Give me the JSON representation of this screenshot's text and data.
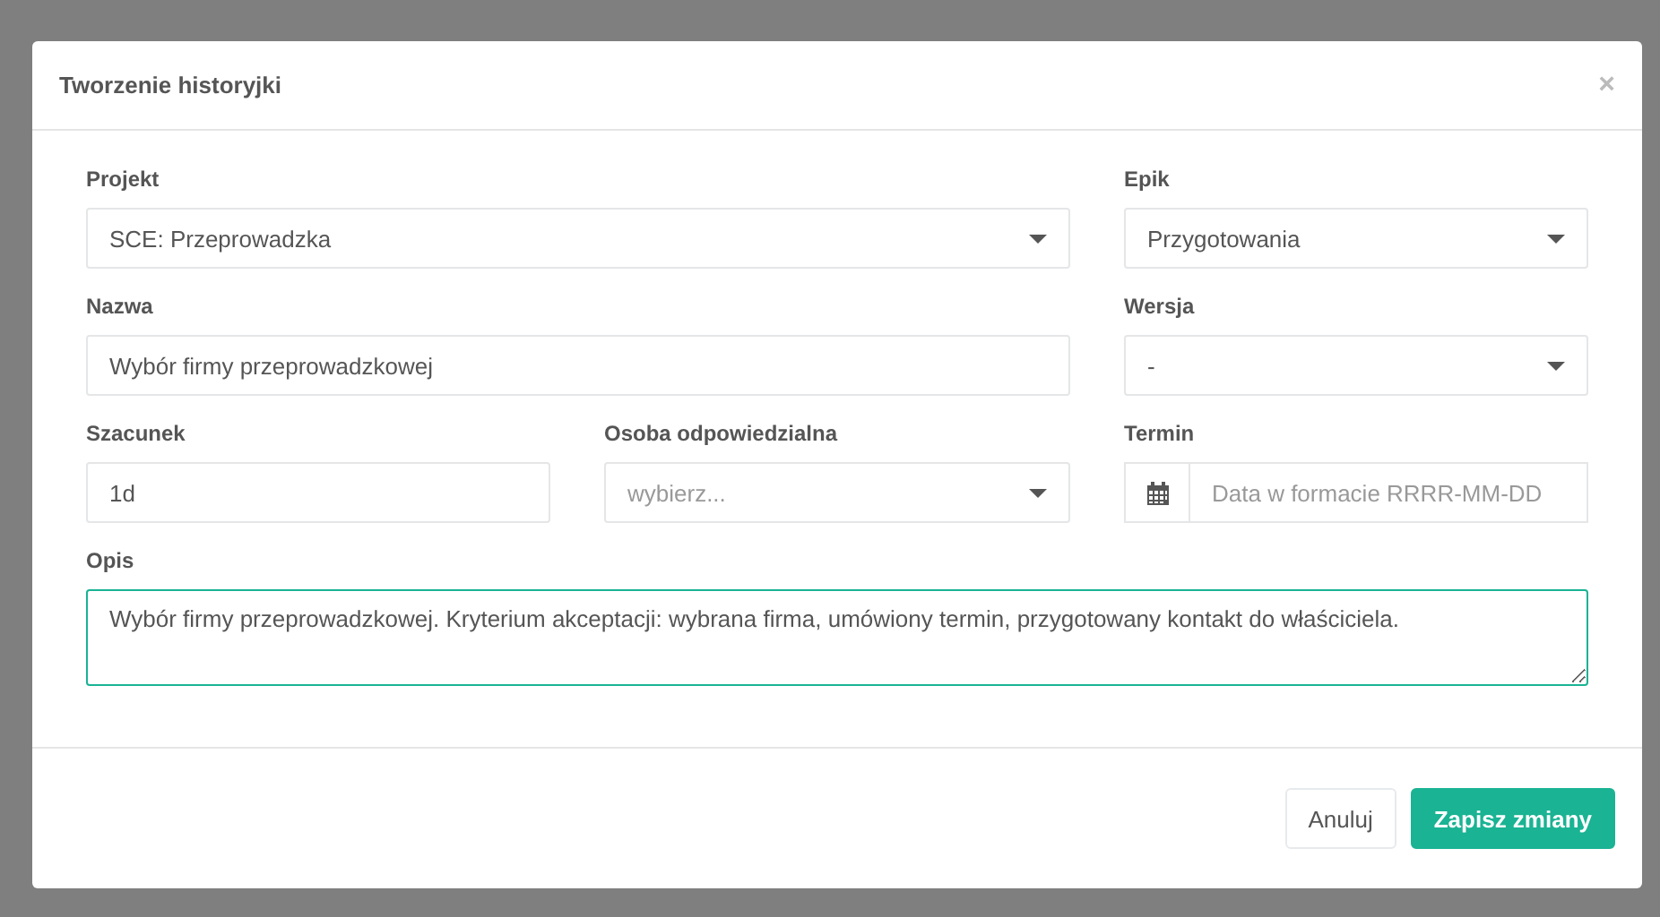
{
  "dialog": {
    "title": "Tworzenie historyjki",
    "close": "×"
  },
  "fields": [
    {
      "kind": "select",
      "label": "Projekt",
      "value": "SCE: Przeprowadzka"
    },
    {
      "kind": "select",
      "label": "Epik",
      "value": "Przygotowania"
    },
    {
      "kind": "text",
      "label": "Nazwa",
      "value": "Wybór firmy przeprowadzkowej"
    },
    {
      "kind": "select",
      "label": "Wersja",
      "value": "-"
    },
    {
      "kind": "text",
      "label": "Szacunek",
      "value": "1d"
    },
    {
      "kind": "select",
      "label": "Osoba odpowiedzialna",
      "placeholder": "wybierz..."
    },
    {
      "kind": "date",
      "label": "Termin",
      "placeholder": "Data w formacie RRRR-MM-DD"
    },
    {
      "kind": "textarea",
      "label": "Opis",
      "value": "Wybór firmy przeprowadzkowej. Kryterium akceptacji: wybrana firma, umówiony termin, przygotowany kontakt do właściciela.",
      "focused": true
    }
  ],
  "buttons": [
    {
      "label": "Anuluj",
      "primary": false
    },
    {
      "label": "Zapisz zmiany",
      "primary": true
    }
  ]
}
